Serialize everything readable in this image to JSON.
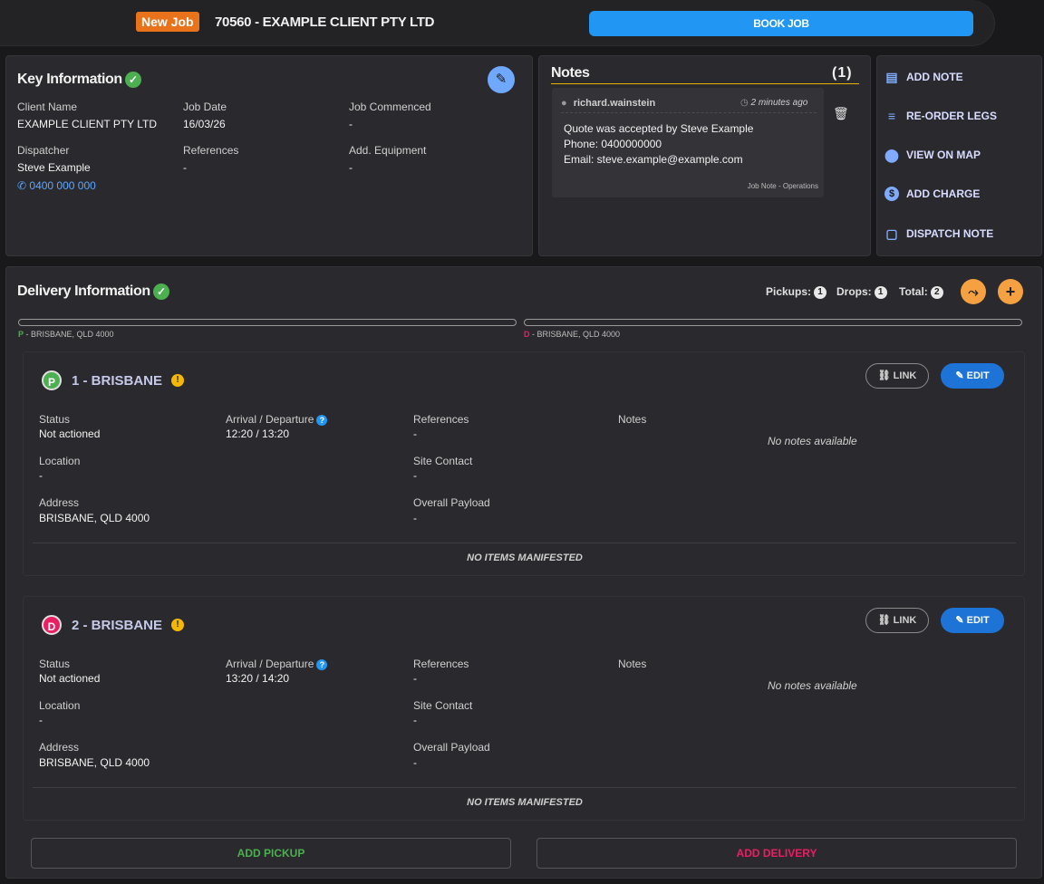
{
  "header": {
    "badge": "New Job",
    "title": "70560 - EXAMPLE CLIENT PTY LTD",
    "book_button": "BOOK JOB"
  },
  "key_info": {
    "title": "Key Information",
    "client_name_label": "Client Name",
    "client_name": "EXAMPLE CLIENT PTY LTD",
    "job_date_label": "Job Date",
    "job_date": "16/03/26",
    "job_commenced_label": "Job Commenced",
    "job_commenced": "-",
    "dispatcher_label": "Dispatcher",
    "dispatcher": "Steve Example",
    "dispatcher_phone": "0400 000 000",
    "references_label": "References",
    "references": "-",
    "add_equipment_label": "Add. Equipment",
    "add_equipment": "-"
  },
  "notes": {
    "title": "Notes",
    "count": "(1)",
    "items": [
      {
        "author": "richard.wainstein",
        "time": "2 minutes ago",
        "line1": "Quote was accepted by Steve Example",
        "line2": "Phone: 0400000000",
        "line3": "Email: steve.example@example.com",
        "type": "Job Note - Operations"
      }
    ]
  },
  "actions": {
    "add_note": "ADD NOTE",
    "reorder_legs": "RE-ORDER LEGS",
    "view_on_map": "VIEW ON MAP",
    "add_charge": "ADD CHARGE",
    "dispatch_note": "DISPATCH NOTE"
  },
  "delivery": {
    "title": "Delivery Information",
    "pickups_label": "Pickups:",
    "pickups": "1",
    "drops_label": "Drops:",
    "drops": "1",
    "total_label": "Total:",
    "total": "2",
    "progress": [
      {
        "prefix": "P",
        "label": " - BRISBANE, QLD 4000"
      },
      {
        "prefix": "D",
        "label": " - BRISBANE, QLD 4000"
      }
    ],
    "legs": [
      {
        "badge": "P",
        "title": "1 - BRISBANE",
        "link": "LINK",
        "edit": "EDIT",
        "status_label": "Status",
        "status": "Not actioned",
        "arrival_label": "Arrival / Departure",
        "arrival": "12:20 / 13:20",
        "references_label": "References",
        "references": "-",
        "notes_label": "Notes",
        "notes": "No notes available",
        "location_label": "Location",
        "location": "-",
        "site_contact_label": "Site Contact",
        "site_contact": "-",
        "address_label": "Address",
        "address": "BRISBANE, QLD 4000",
        "payload_label": "Overall Payload",
        "payload": "-",
        "manifest": "NO ITEMS MANIFESTED"
      },
      {
        "badge": "D",
        "title": "2 - BRISBANE",
        "link": "LINK",
        "edit": "EDIT",
        "status_label": "Status",
        "status": "Not actioned",
        "arrival_label": "Arrival / Departure",
        "arrival": "13:20 / 14:20",
        "references_label": "References",
        "references": "-",
        "notes_label": "Notes",
        "notes": "No notes available",
        "location_label": "Location",
        "location": "-",
        "site_contact_label": "Site Contact",
        "site_contact": "-",
        "address_label": "Address",
        "address": "BRISBANE, QLD 4000",
        "payload_label": "Overall Payload",
        "payload": "-",
        "manifest": "NO ITEMS MANIFESTED"
      }
    ],
    "add_pickup": "ADD PICKUP",
    "add_delivery": "ADD DELIVERY"
  },
  "colors": {
    "accent": "#2196f3",
    "badge_orange": "#e8731a",
    "pickup_green": "#4caf50",
    "drop_pink": "#e91e63",
    "add_pickup_text": "#4caf50",
    "add_delivery_text": "#e91e63"
  }
}
